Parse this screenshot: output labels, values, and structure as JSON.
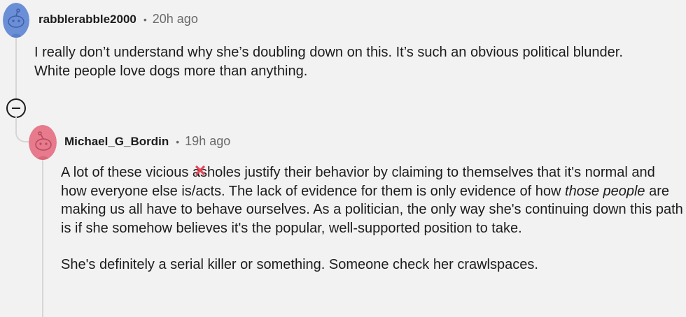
{
  "comments": [
    {
      "username": "rabblerabble2000",
      "separator": "•",
      "time": "20h ago",
      "avatar_color": "#6b8fd6",
      "text": "I really don’t understand why she’s doubling down on this. It’s such an obvious political blunder. White people love dogs more than anything."
    },
    {
      "username": "Michael_G_Bordin",
      "separator": "•",
      "time": "19h ago",
      "avatar_color": "#e77a8c",
      "para1": {
        "part1": "A lot of these vicious a",
        "part2": "sholes justify their behavior by claiming to themselves that it's normal and how everyone else is/acts. The lack of evidence for them is only evidence of how ",
        "italic": "those people",
        "part3": " are making us all have to behave ourselves. As a politician, the only way she's continuing down this path is if she somehow believes it's the popular, well-supported position to take."
      },
      "para2": "She's definitely a serial killer or something. Someone check her crawlspaces."
    }
  ],
  "colors": {
    "background": "#f2f2f2",
    "thread_line": "#d6d6d6",
    "censor_mark": "#e8445a"
  }
}
